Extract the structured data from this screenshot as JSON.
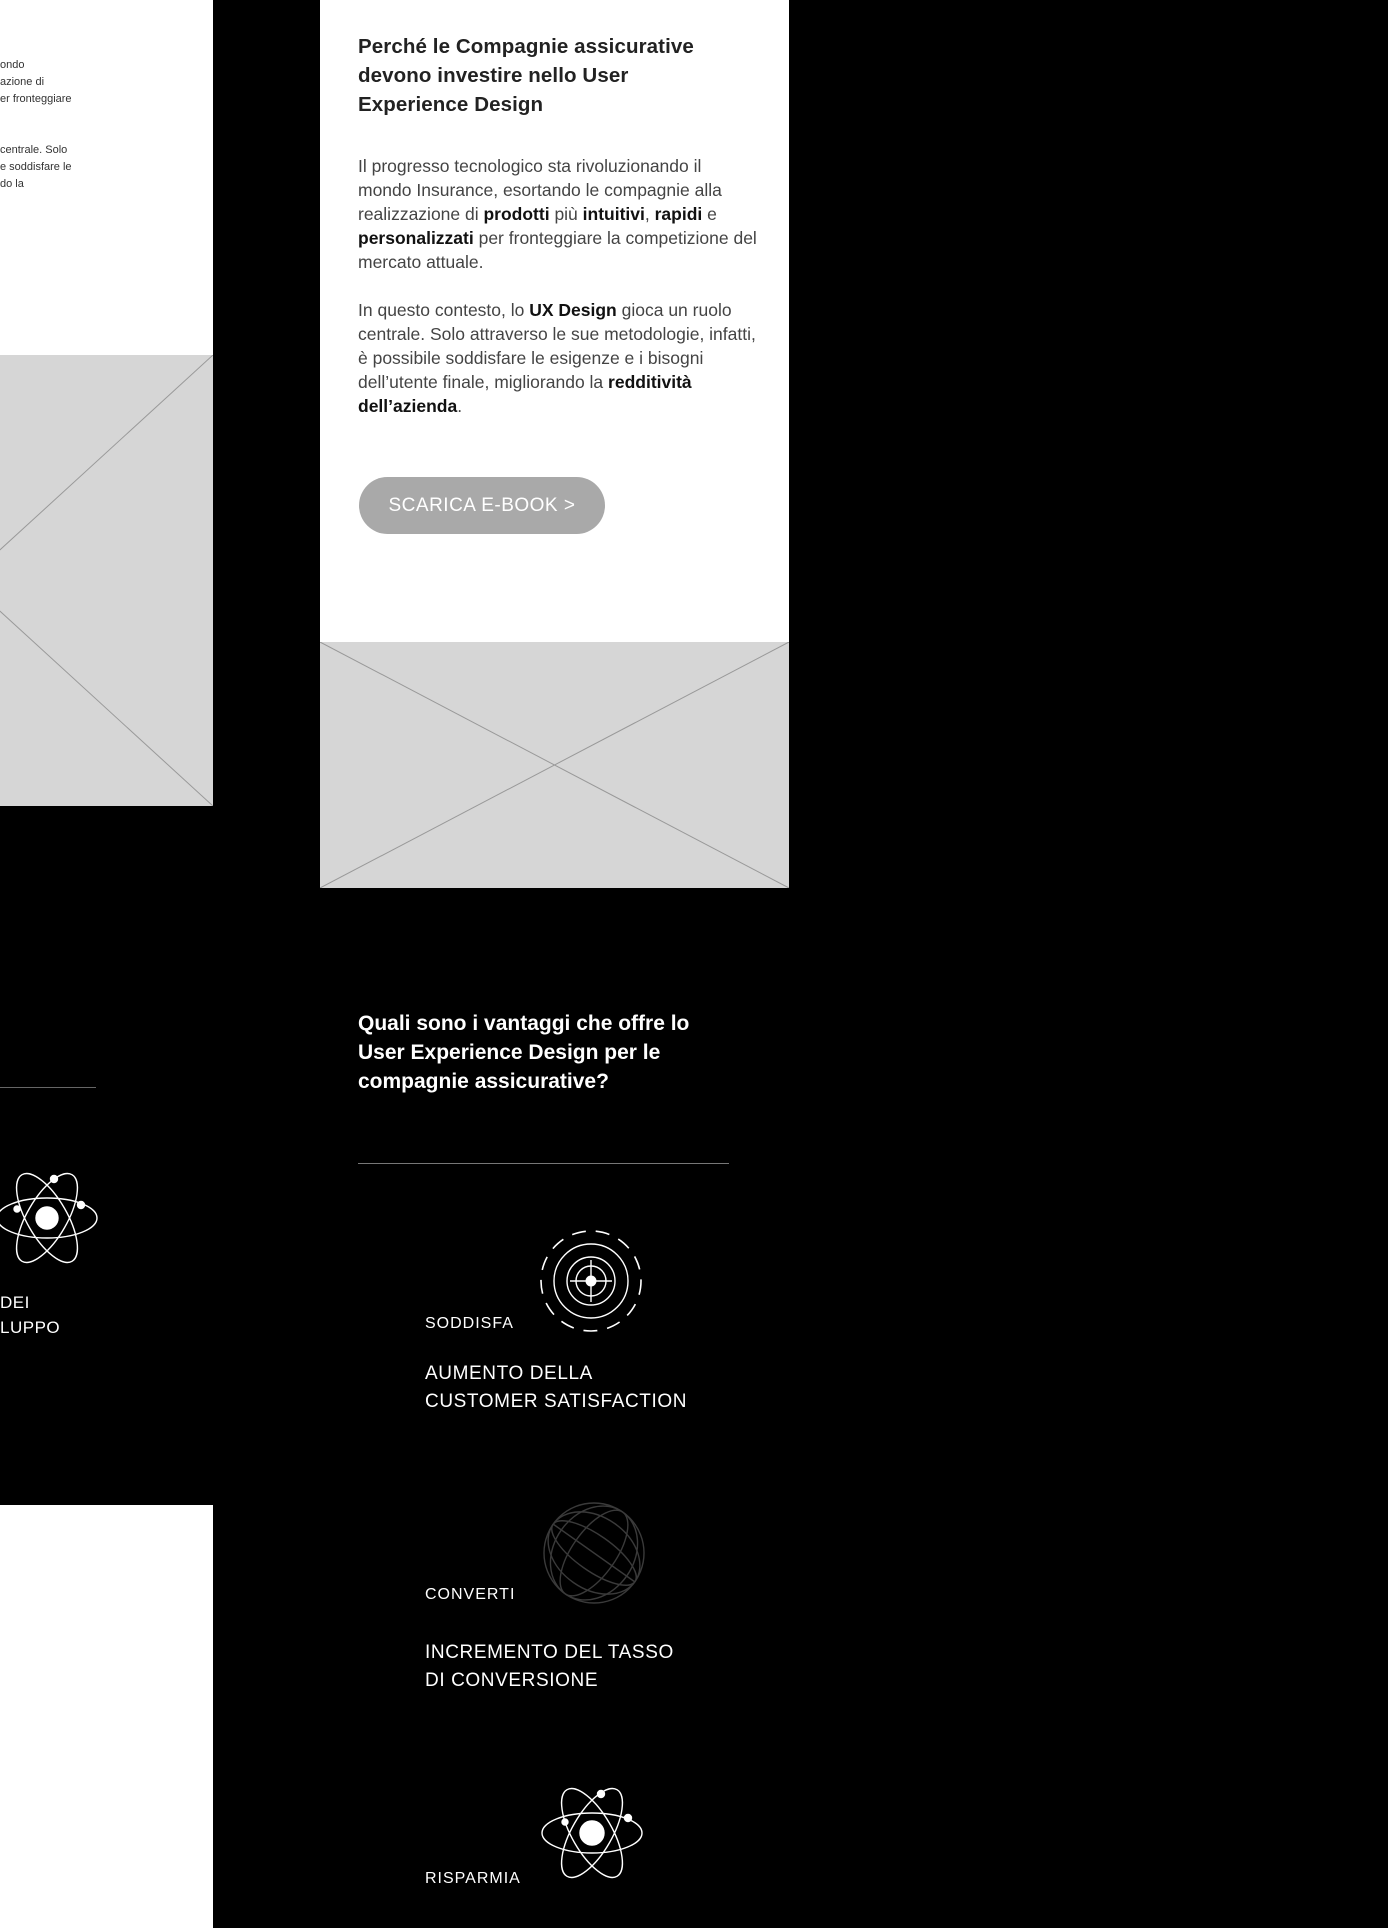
{
  "left_column": {
    "snippets": [
      {
        "text": "ondo"
      },
      {
        "text": "azione di"
      },
      {
        "text": "er fronteggiare"
      },
      {
        "text": "centrale. Solo"
      },
      {
        "text": "e soddisfare le"
      },
      {
        "text": "do la"
      }
    ],
    "feature_text": "DEI\nLUPPO"
  },
  "card": {
    "title": "Perché le Compagnie assicurative devono investire nello User Experience Design",
    "paragraph1": [
      {
        "text": "Il progresso tecnologico sta rivoluzionando il mondo Insurance, esortando le compagnie alla realizzazione di ",
        "bold": false
      },
      {
        "text": "prodotti",
        "bold": true
      },
      {
        "text": " più ",
        "bold": false
      },
      {
        "text": "intuitivi",
        "bold": true
      },
      {
        "text": ", ",
        "bold": false
      },
      {
        "text": "rapidi",
        "bold": true
      },
      {
        "text": " e ",
        "bold": false
      },
      {
        "text": "personalizzati",
        "bold": true
      },
      {
        "text": " per fronteggiare la competizione del mercato attuale.",
        "bold": false
      }
    ],
    "paragraph2": [
      {
        "text": "In questo contesto, lo ",
        "bold": false
      },
      {
        "text": "UX Design",
        "bold": true
      },
      {
        "text": " gioca un ruolo centrale. Solo attraverso le sue metodologie, infatti, è possibile soddisfare le esigenze e i bisogni dell’utente finale, migliorando la ",
        "bold": false
      },
      {
        "text": "redditività dell’azienda",
        "bold": true
      },
      {
        "text": ".",
        "bold": false
      }
    ],
    "cta_label": "SCARICA E-BOOK >"
  },
  "advantages": {
    "title": "Quali sono i vantaggi che offre lo User Experience Design per le compagnie assicurative?",
    "items": [
      {
        "label": "SODDISFA",
        "title": "AUMENTO DELLA\nCUSTOMER SATISFACTION",
        "icon": "target-icon"
      },
      {
        "label": "CONVERTI",
        "title": "INCREMENTO DEL TASSO\nDI CONVERSIONE",
        "icon": "globe-icon"
      },
      {
        "label": "RISPARMIA",
        "title": "",
        "icon": "atom-icon"
      }
    ]
  },
  "colors": {
    "background": "#000000",
    "card": "#ffffff",
    "placeholder": "#d6d6d6",
    "cta": "#a9a9a9"
  }
}
